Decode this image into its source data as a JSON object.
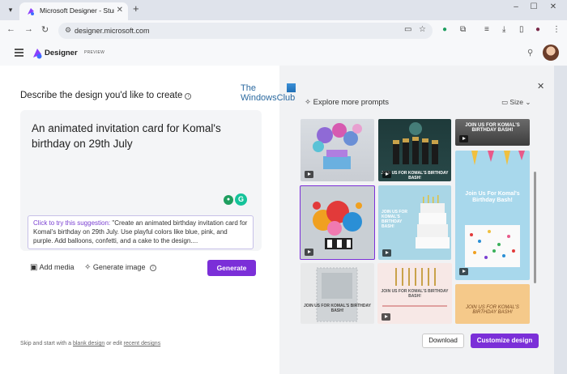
{
  "browser": {
    "tab_title": "Microsoft Designer - Stunning",
    "tab_close": "✕",
    "new_tab": "+",
    "url": "designer.microsoft.com"
  },
  "app": {
    "name": "Designer",
    "preview_tag": "PREVIEW"
  },
  "left": {
    "title": "Describe the design you'd like to create",
    "prompt": "An animated invitation card for Komal's birthday on 29th July",
    "suggestion_hint": "Click to try this suggestion:",
    "suggestion_text": "\"Create an animated birthday invitation card for Komal's birthday on 29th July. Use playful colors like blue, pink, and purple. Add balloons, confetti, and a cake to the design....",
    "add_media": "Add media",
    "generate_image": "Generate image",
    "generate_button": "Generate",
    "skip_prefix": "Skip and start with a",
    "skip_blank": "blank design",
    "skip_mid": "or edit",
    "skip_recent": "recent designs"
  },
  "watermark": {
    "line1": "The",
    "line2": "WindowsClub"
  },
  "right": {
    "explore": "Explore more prompts",
    "size": "Size",
    "thumbnails": {
      "t2_caption": "JOIN US FOR KOMAL'S BIRTHDAY BASH!",
      "t3_caption": "JOIN US FOR KOMAL'S BIRTHDAY BASH!",
      "t4_caption": "JOIN US FOR KOMAL'S BIRTHDAY BASH!",
      "t5_caption": "JOIN US FOR KOMAL'S BIRTHDAY BASH!",
      "t6_caption": "JOIN US FOR KOMAL'S BIRTHDAY BASH!",
      "t7_caption": "Join Us For Komal's Birthday Bash!",
      "t8_caption": "JOIN US FOR KOMAL'S BIRTHDAY BASH!",
      "t9_caption": "JOIN US FOR KOMAL'S BIRTHDAY BASH!",
      "t10_caption": "Join Us For Komal's Birthday Bash!"
    },
    "download_button": "Download",
    "customize_button": "Customize design"
  },
  "colors": {
    "accent": "#7b2fd8",
    "chrome": "#dfe3eb"
  }
}
